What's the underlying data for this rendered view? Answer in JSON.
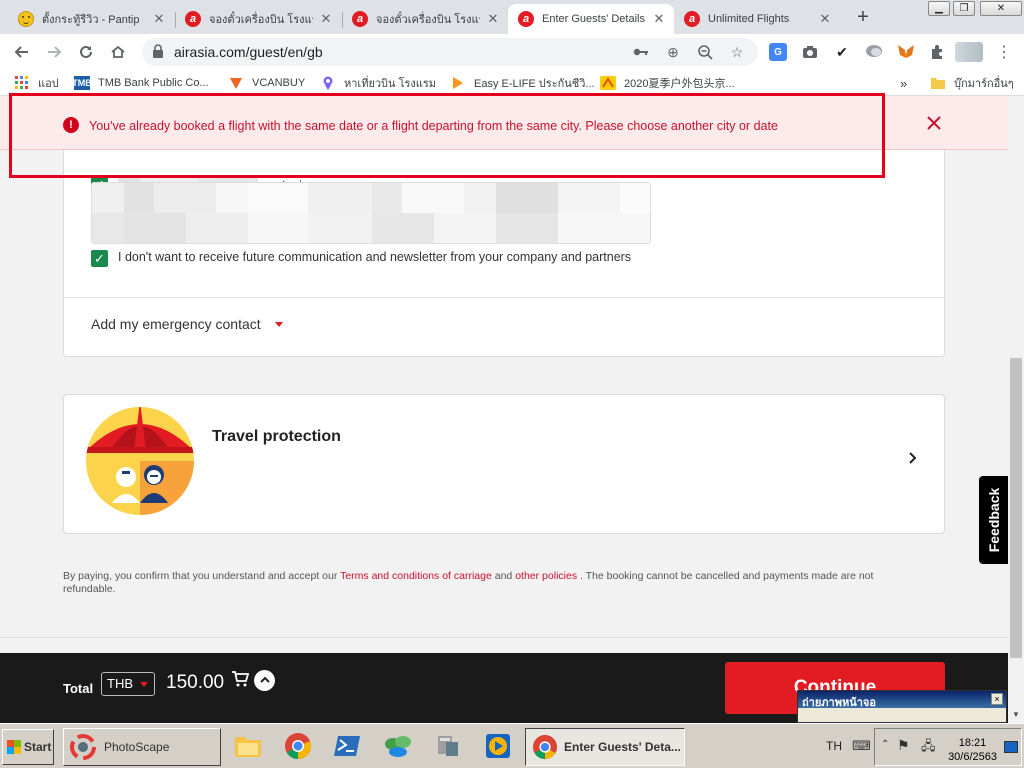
{
  "browser": {
    "tabs": [
      {
        "title": "ตั้งกระทู้รีวิว - Pantip",
        "icon": "pantip-smiley-icon"
      },
      {
        "title": "จองตั๋วเครื่องบิน โรงแรม",
        "icon": "airasia-icon"
      },
      {
        "title": "จองตั๋วเครื่องบิน โรงแรม",
        "icon": "airasia-icon"
      },
      {
        "title": "Enter Guests' Details",
        "icon": "airasia-icon"
      },
      {
        "title": "Unlimited Flights",
        "icon": "airasia-icon"
      }
    ],
    "url": "airasia.com/guest/en/gb",
    "bookmarks": [
      {
        "label": "แอป",
        "icon": "apps-grid-icon"
      },
      {
        "label": "TMB Bank Public Co...",
        "icon": "tmb-icon"
      },
      {
        "label": "VCANBUY",
        "icon": "vcanbuy-icon"
      },
      {
        "label": "หาเที่ยวบิน โรงแรม",
        "icon": "hotel-pin-icon"
      },
      {
        "label": "Easy E-LIFE ประกันชีวิ...",
        "icon": "play-arrow-icon"
      },
      {
        "label": "2020夏季户外包头京...",
        "icon": "shop-icon"
      }
    ],
    "bookmarks_more": "»",
    "other_bookmarks": "บุ๊กมาร์กอื่นๆ"
  },
  "error": {
    "message": "You've already booked a flight with the same date or a flight departing from the same city. Please choose another city or date",
    "icon": "!"
  },
  "contact": {
    "checkbox_suffix": "contact person",
    "optout_label": "I don't want to receive future communication and newsletter from your company and partners",
    "emergency_label": "Add my emergency contact"
  },
  "travel_protection": {
    "title": "Travel protection"
  },
  "terms": {
    "prefix": "By paying, you confirm that you understand and accept our",
    "link1": "Terms and conditions of carriage",
    "and": "and",
    "link2": "other policies",
    "suffix": ". The booking cannot be cancelled and payments made are not refundable."
  },
  "footer": {
    "total_label": "Total",
    "currency": "THB",
    "amount": "150.00",
    "continue_label": "Continue"
  },
  "feedback_label": "Feedback",
  "popup": {
    "title": "ถ่ายภาพหน้าจอ",
    "close": "×"
  },
  "taskbar": {
    "start_label": "Start",
    "tasks": [
      {
        "label": "PhotoScape"
      },
      {
        "label": "Enter Guests' Deta..."
      }
    ],
    "language": "TH",
    "time": "18:21",
    "date": "30/6/2563"
  },
  "colors": {
    "brand_red": "#e31b23",
    "error_text": "#c8102e",
    "checkbox_green": "#1a8a4c",
    "footer_bg": "#1a1a1a"
  }
}
